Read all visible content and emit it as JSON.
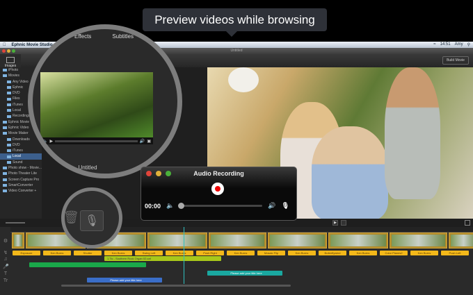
{
  "callout": "Preview videos while browsing",
  "menubar": {
    "app": "Ephnic Movie Studio",
    "time": "14:51",
    "user": "Amy"
  },
  "window": {
    "title": "Untitled"
  },
  "toolbar": {
    "build": "Build Movie",
    "tab_effects": "Effects",
    "tab_subtitles": "Subtitles"
  },
  "sidebar": {
    "images": "Images"
  },
  "tree": [
    {
      "label": "iPhoto",
      "sel": false
    },
    {
      "label": "Movies",
      "sel": false
    },
    {
      "label": "Any Video",
      "sel": false
    },
    {
      "label": "Ephnic",
      "sel": false
    },
    {
      "label": "DVD",
      "sel": false
    },
    {
      "label": "Files",
      "sel": false
    },
    {
      "label": "iTunes",
      "sel": false
    },
    {
      "label": "Local",
      "sel": false
    },
    {
      "label": "Recordings",
      "sel": false
    },
    {
      "label": "Ephnic Movie",
      "sel": false
    },
    {
      "label": "Ephnic Video",
      "sel": false
    },
    {
      "label": "Movie Maker",
      "sel": false
    },
    {
      "label": "Downloads",
      "sel": false
    },
    {
      "label": "DVD",
      "sel": false
    },
    {
      "label": "iTunes",
      "sel": false
    },
    {
      "label": "Local",
      "sel": true
    },
    {
      "label": "Sound",
      "sel": false
    },
    {
      "label": "Photo show - Movie...",
      "sel": false
    },
    {
      "label": "Photo Theater Lite",
      "sel": false
    },
    {
      "label": "Screen Capture Pro",
      "sel": false
    },
    {
      "label": "SmartConverter",
      "sel": false
    },
    {
      "label": "Video Converter +",
      "sel": false
    }
  ],
  "preview_clip": {
    "title": "Untitled"
  },
  "audio_recording": {
    "title": "Audio Recording",
    "time": "00:00",
    "volume": 0
  },
  "transitions": [
    "Exposure",
    "Ken Burns",
    "Shutter",
    "Ken Burns",
    "Swing Left",
    "Ken Burns",
    "Push Right",
    "Ken Burns",
    "Mosaic Flip",
    "Ken Burns",
    "Butterflywind",
    "Ken Burns",
    "Color Planes2",
    "Ken Burns",
    "Push Left"
  ],
  "music_track": "1.Tic - Southern Rock Organ 02.caf",
  "titles": [
    "Please add your title here",
    "Please add your title here"
  ],
  "colors": {
    "transition": "#f3b81a",
    "music": "#a8c81a",
    "voice": "#1aa84a",
    "title": "#1aa8a0",
    "title2": "#3a6ec8",
    "playhead": "#2ec0c0"
  }
}
